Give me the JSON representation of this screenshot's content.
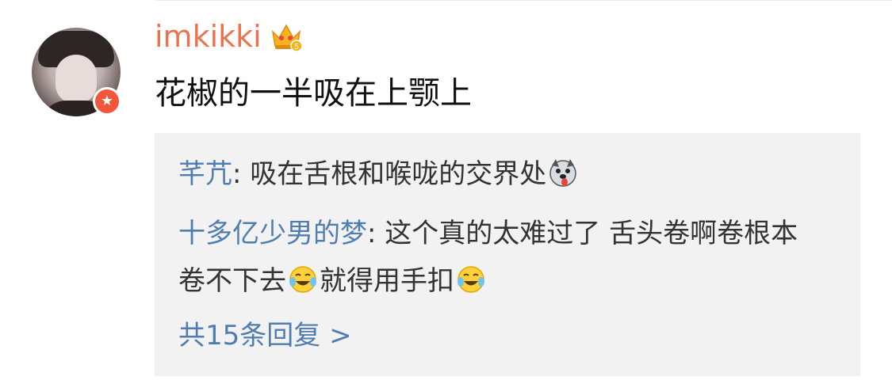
{
  "comment": {
    "username": "imkikki",
    "text": "花椒的一半吸在上颚上"
  },
  "badges": {
    "vip_icon": "crown-icon",
    "verified_icon": "star-badge-icon",
    "vip_level": "5"
  },
  "replies": [
    {
      "name": "芊芁",
      "text": "吸在舌根和喉咙的交界处",
      "trailing_emoji": "husky-tongue-emoji"
    },
    {
      "name": "十多亿少男的梦",
      "text_part1": "这个真的太难过了 舌头卷啊卷根本卷不下去",
      "emoji1": "laugh-cry-emoji",
      "text_part2": "就得用手扣",
      "emoji2": "laugh-cry-emoji"
    }
  ],
  "more_replies": {
    "label": "共15条回复",
    "chevron": ">"
  },
  "colors": {
    "username": "#eb7350",
    "link_blue": "#507daf",
    "reply_bg": "#f2f2f2",
    "badge_red": "#f2563b"
  }
}
